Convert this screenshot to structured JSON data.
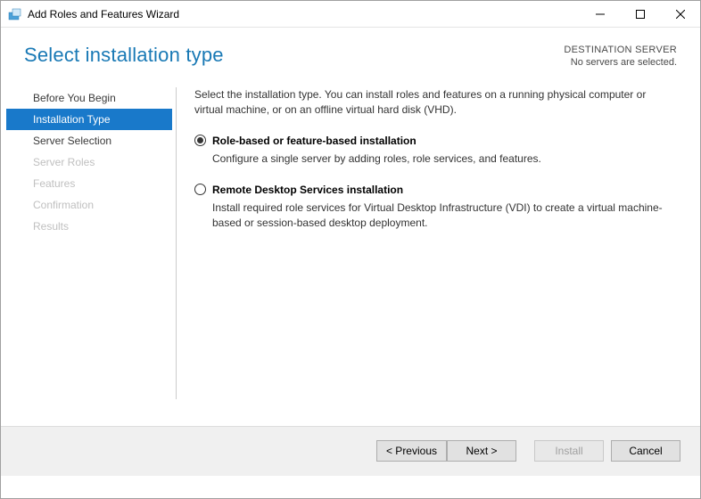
{
  "titlebar": {
    "title": "Add Roles and Features Wizard"
  },
  "header": {
    "page_title": "Select installation type",
    "dest_label": "DESTINATION SERVER",
    "dest_value": "No servers are selected."
  },
  "steps": [
    {
      "label": "Before You Begin",
      "state": "enabled"
    },
    {
      "label": "Installation Type",
      "state": "active"
    },
    {
      "label": "Server Selection",
      "state": "enabled"
    },
    {
      "label": "Server Roles",
      "state": "disabled"
    },
    {
      "label": "Features",
      "state": "disabled"
    },
    {
      "label": "Confirmation",
      "state": "disabled"
    },
    {
      "label": "Results",
      "state": "disabled"
    }
  ],
  "main": {
    "intro": "Select the installation type. You can install roles and features on a running physical computer or virtual machine, or on an offline virtual hard disk (VHD).",
    "options": [
      {
        "title": "Role-based or feature-based installation",
        "desc": "Configure a single server by adding roles, role services, and features.",
        "selected": true
      },
      {
        "title": "Remote Desktop Services installation",
        "desc": "Install required role services for Virtual Desktop Infrastructure (VDI) to create a virtual machine-based or session-based desktop deployment.",
        "selected": false
      }
    ]
  },
  "footer": {
    "previous": "< Previous",
    "next": "Next >",
    "install": "Install",
    "cancel": "Cancel"
  }
}
